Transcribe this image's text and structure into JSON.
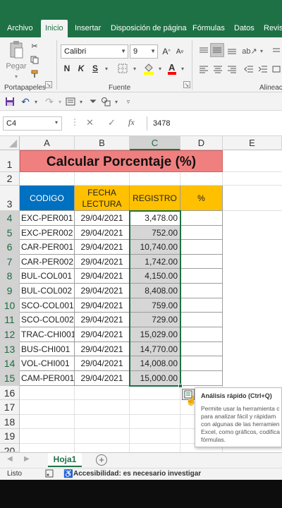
{
  "ribbon": {
    "tabs": [
      "Archivo",
      "Inicio",
      "Insertar",
      "Disposición de página",
      "Fórmulas",
      "Datos",
      "Revisa"
    ],
    "paste_label": "Pegar",
    "font_name": "Calibri",
    "font_size": "9",
    "font_buttons": [
      "N",
      "K",
      "S"
    ],
    "group_labels": [
      "Portapapeles",
      "Fuente",
      "Alineaci"
    ]
  },
  "formula_bar": {
    "name_box": "C4",
    "fx": "fx",
    "value": "3478"
  },
  "sheet": {
    "columns": [
      "A",
      "B",
      "C",
      "D",
      "E"
    ],
    "rows": [
      "1",
      "2",
      "3",
      "4",
      "5",
      "6",
      "7",
      "8",
      "9",
      "10",
      "11",
      "12",
      "13",
      "14",
      "15",
      "16",
      "17",
      "18",
      "19",
      "20"
    ],
    "title": "Calcular Porcentaje (%)",
    "headers": {
      "codigo": "CODIGO",
      "fecha_line1": "FECHA",
      "fecha_line2": "LECTURA",
      "registro": "REGISTRO",
      "porcentaje": "%"
    },
    "data": [
      {
        "codigo": "EXC-PER001",
        "fecha": "29/04/2021",
        "registro": "3,478.00"
      },
      {
        "codigo": "EXC-PER002",
        "fecha": "29/04/2021",
        "registro": "752.00"
      },
      {
        "codigo": "CAR-PER001",
        "fecha": "29/04/2021",
        "registro": "10,740.00"
      },
      {
        "codigo": "CAR-PER002",
        "fecha": "29/04/2021",
        "registro": "1,742.00"
      },
      {
        "codigo": "BUL-COL001",
        "fecha": "29/04/2021",
        "registro": "4,150.00"
      },
      {
        "codigo": "BUL-COL002",
        "fecha": "29/04/2021",
        "registro": "8,408.00"
      },
      {
        "codigo": "SCO-COL001",
        "fecha": "29/04/2021",
        "registro": "759.00"
      },
      {
        "codigo": "SCO-COL002",
        "fecha": "29/04/2021",
        "registro": "729.00"
      },
      {
        "codigo": "TRAC-CHI001",
        "fecha": "29/04/2021",
        "registro": "15,029.00"
      },
      {
        "codigo": "BUS-CHI001",
        "fecha": "29/04/2021",
        "registro": "14,770.00"
      },
      {
        "codigo": "VOL-CHI001",
        "fecha": "29/04/2021",
        "registro": "14,008.00"
      },
      {
        "codigo": "CAM-PER001",
        "fecha": "29/04/2021",
        "registro": "15,000.00"
      }
    ]
  },
  "quick_analysis": {
    "title": "Análisis rápido (Ctrl+Q)",
    "lines": [
      "Permite usar la herramienta c",
      "para analizar fácil y rápidam",
      "con algunas de las herramien",
      "Excel, como gráficos, codifica",
      "fórmulas."
    ]
  },
  "sheet_tabs": {
    "active": "Hoja1",
    "add": "+"
  },
  "status": {
    "ready": "Listo",
    "accessibility": "Accesibilidad: es necesario investigar"
  },
  "colors": {
    "excel_green": "#1e7145",
    "title_fill": "#f08080",
    "header_blue": "#0070c0",
    "header_yellow": "#ffc000",
    "selection_gray": "#d6d6d6"
  }
}
